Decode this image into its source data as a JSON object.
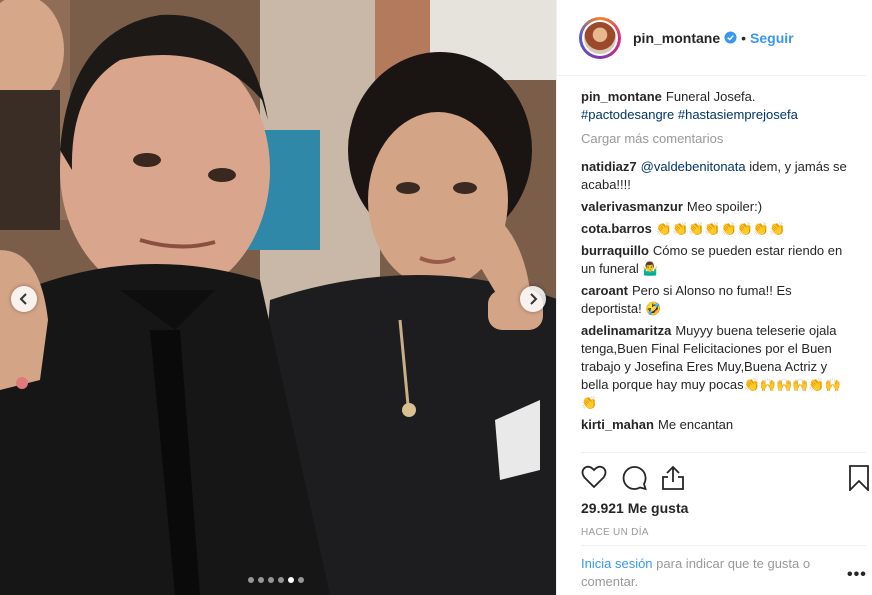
{
  "post": {
    "username": "pin_montane",
    "follow_label": "Seguir",
    "separator": "•",
    "caption_text": "Funeral Josefa.",
    "caption_tags": "#pactodesangre #hastasiemprejosefa",
    "load_more": "Cargar más comentarios",
    "likes": "29.921 Me gusta",
    "time": "HACE UN DÍA",
    "login_link": "Inicia sesión",
    "login_text": "para indicar que te gusta o comentar.",
    "more_label": "•••"
  },
  "comments": [
    {
      "user": "natidiaz7",
      "mention": "@valdebenitonata",
      "text": "idem, y jamás se acaba!!!!"
    },
    {
      "user": "valerivasmanzur",
      "mention": "",
      "text": "Meo spoiler:)"
    },
    {
      "user": "cota.barros",
      "mention": "",
      "text": "👏👏👏👏👏👏👏👏"
    },
    {
      "user": "burraquillo",
      "mention": "",
      "text": "Cómo se pueden estar riendo en un funeral 🤷‍♂️"
    },
    {
      "user": "caroant",
      "mention": "",
      "text": "Pero si Alonso no fuma!! Es deportista! 🤣"
    },
    {
      "user": "adelinamaritza",
      "mention": "",
      "text": "Muyyy buena teleserie ojala tenga,Buen Final Felicitaciones por el Buen trabajo y Josefina Eres Muy,Buena Actriz y bella porque hay muy pocas👏🙌🙌🙌👏🙌👏"
    },
    {
      "user": "kirti_mahan",
      "mention": "",
      "text": "Me encantan"
    }
  ],
  "carousel": {
    "count": 6,
    "active_index": 4
  },
  "icons": {
    "verified": "verified-badge-icon",
    "like": "heart-icon",
    "comment": "comment-bubble-icon",
    "share": "share-icon",
    "save": "bookmark-icon",
    "prev": "chevron-left-icon",
    "next": "chevron-right-icon"
  },
  "colors": {
    "link": "#3897f0",
    "text": "#262626",
    "muted": "#999999",
    "hashtag": "#003569"
  }
}
